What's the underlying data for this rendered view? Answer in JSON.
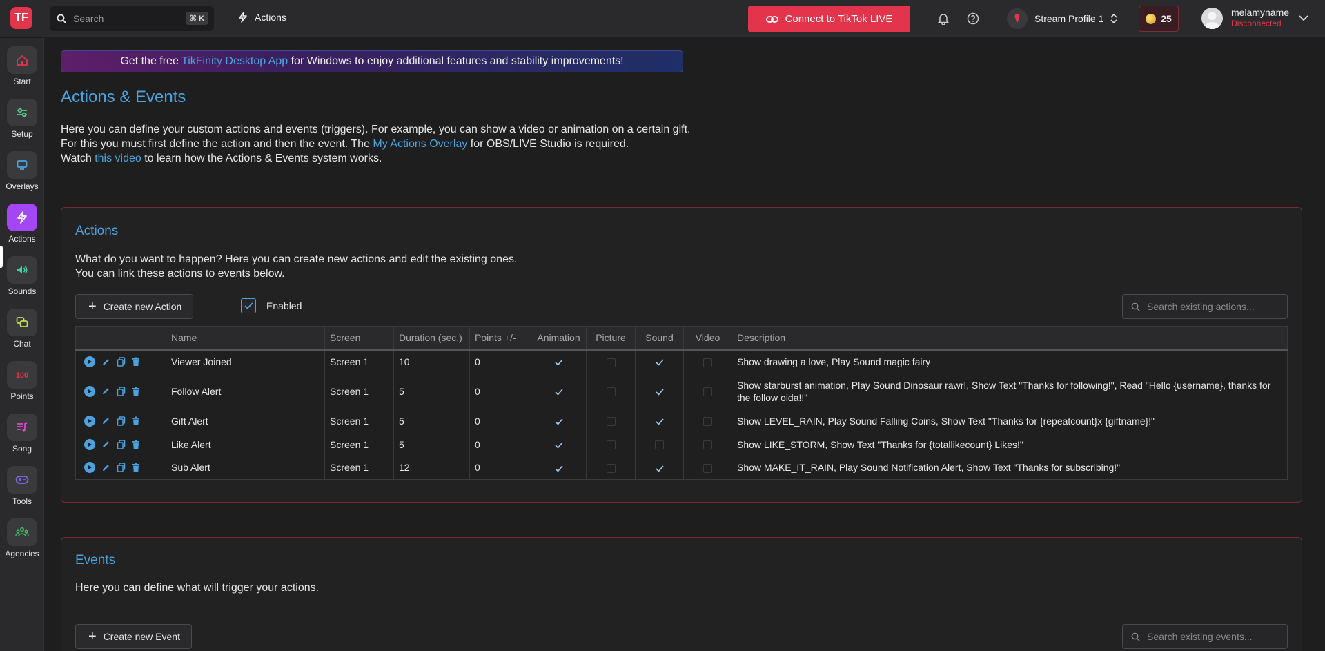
{
  "topbar": {
    "logo_text": "TF",
    "search_placeholder": "Search",
    "search_shortcut": "⌘ K",
    "current_section": "Actions",
    "connect_label": "Connect to TikTok LIVE",
    "profile_label": "Stream Profile 1",
    "coins": "25",
    "username": "melamyname",
    "status": "Disconnected"
  },
  "sidebar": {
    "items": [
      {
        "label": "Start",
        "icon": "home-icon",
        "color": "#e2344a"
      },
      {
        "label": "Setup",
        "icon": "sliders-icon",
        "color": "#4fd38a"
      },
      {
        "label": "Overlays",
        "icon": "monitor-icon",
        "color": "#4aa3df"
      },
      {
        "label": "Actions",
        "icon": "bolt-icon",
        "color": "#ffffff"
      },
      {
        "label": "Sounds",
        "icon": "speaker-icon",
        "color": "#3fd2a8"
      },
      {
        "label": "Chat",
        "icon": "chat-icon",
        "color": "#c4e04a"
      },
      {
        "label": "Points",
        "icon": "points-icon",
        "color": "#e2344a"
      },
      {
        "label": "Song",
        "icon": "music-icon",
        "color": "#e24ad1"
      },
      {
        "label": "Tools",
        "icon": "gamepad-icon",
        "color": "#7b6cf0"
      },
      {
        "label": "Agencies",
        "icon": "agency-icon",
        "color": "#3fb86a"
      }
    ]
  },
  "promo": {
    "prefix": "Get the free ",
    "link": "TikFinity Desktop App",
    "suffix": " for Windows to enjoy additional features and stability improvements!"
  },
  "page": {
    "title": "Actions & Events",
    "intro_line1": "Here you can define your custom actions and events (triggers). For example, you can show a video or animation on a certain gift.",
    "intro_line2_prefix": "For this you must first define the action and then the event. The ",
    "intro_line2_link": "My Actions Overlay",
    "intro_line2_suffix": " for OBS/LIVE Studio is required.",
    "intro_line3_prefix": "Watch ",
    "intro_line3_link": "this video",
    "intro_line3_suffix": " to learn how the Actions & Events system works."
  },
  "actions_panel": {
    "title": "Actions",
    "desc_line1": "What do you want to happen? Here you can create new actions and edit the existing ones.",
    "desc_line2": "You can link these actions to events below.",
    "create_label": "Create new Action",
    "enabled_label": "Enabled",
    "search_placeholder": "Search existing actions...",
    "columns": [
      "Name",
      "Screen",
      "Duration (sec.)",
      "Points +/-",
      "Animation",
      "Picture",
      "Sound",
      "Video",
      "Description"
    ],
    "rows": [
      {
        "name": "Viewer Joined",
        "screen": "Screen 1",
        "duration": "10",
        "points": "0",
        "animation": true,
        "picture": false,
        "sound": true,
        "video": false,
        "description": "Show drawing a love, Play Sound magic fairy"
      },
      {
        "name": "Follow Alert",
        "screen": "Screen 1",
        "duration": "5",
        "points": "0",
        "animation": true,
        "picture": false,
        "sound": true,
        "video": false,
        "description": "Show starburst animation, Play Sound Dinosaur rawr!, Show Text \"Thanks for following!\", Read \"Hello {username}, thanks for the follow oida!!\""
      },
      {
        "name": "Gift Alert",
        "screen": "Screen 1",
        "duration": "5",
        "points": "0",
        "animation": true,
        "picture": false,
        "sound": true,
        "video": false,
        "description": "Show LEVEL_RAIN, Play Sound Falling Coins, Show Text \"Thanks for {repeatcount}x {giftname}!\""
      },
      {
        "name": "Like Alert",
        "screen": "Screen 1",
        "duration": "5",
        "points": "0",
        "animation": true,
        "picture": false,
        "sound": false,
        "video": false,
        "description": "Show LIKE_STORM, Show Text \"Thanks for {totallikecount} Likes!\""
      },
      {
        "name": "Sub Alert",
        "screen": "Screen 1",
        "duration": "12",
        "points": "0",
        "animation": true,
        "picture": false,
        "sound": true,
        "video": false,
        "description": "Show MAKE_IT_RAIN, Play Sound Notification Alert, Show Text \"Thanks for subscribing!\""
      }
    ]
  },
  "events_panel": {
    "title": "Events",
    "desc": "Here you can define what will trigger your actions.",
    "create_label": "Create new Event",
    "search_placeholder": "Search existing events..."
  },
  "colors": {
    "accent": "#e2344a",
    "link": "#4aa3df",
    "active_nav": "#a347f4"
  }
}
